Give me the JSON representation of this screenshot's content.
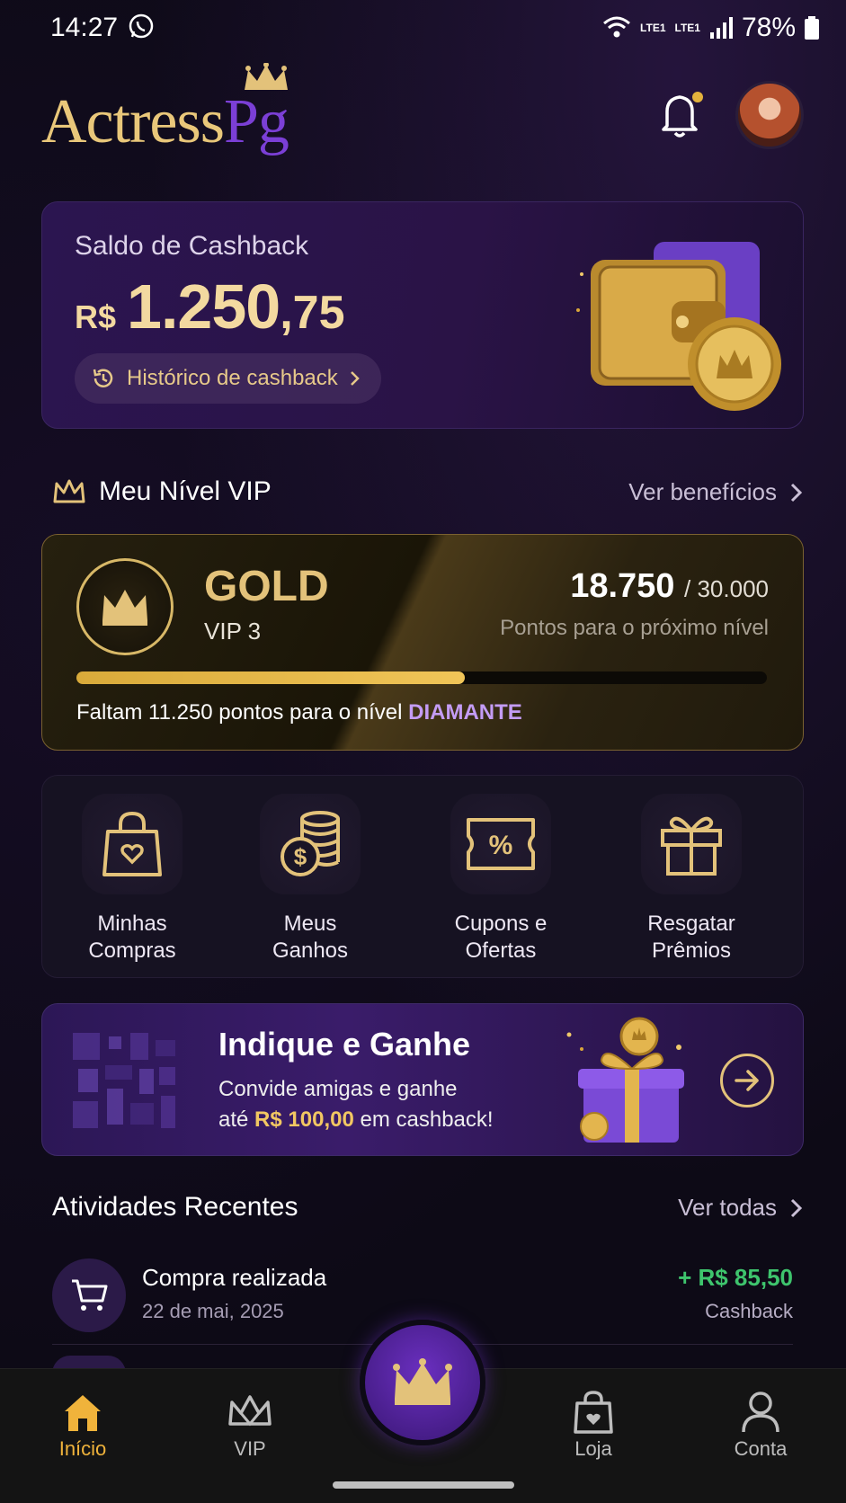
{
  "status_bar": {
    "time": "14:27",
    "net1": "LTE1",
    "net2": "LTE1",
    "battery": "78%"
  },
  "header": {
    "logo_part1": "Actress",
    "logo_part2": "Pg"
  },
  "cashback": {
    "label": "Saldo de Cashback",
    "currency": "R$",
    "amount_int": "1.250",
    "amount_dec": ",75",
    "history_label": "Histórico de cashback"
  },
  "vip_section": {
    "title": "Meu Nível VIP",
    "link": "Ver benefícios"
  },
  "vip_card": {
    "tier": "GOLD",
    "level": "VIP 3",
    "points": "18.750",
    "points_total": "/ 30.000",
    "points_label": "Pontos para o próximo nível",
    "progress": 0.5625,
    "need_text": "Faltam 11.250 pontos para o nível",
    "next_tier": "DIAMANTE"
  },
  "shortcuts": [
    {
      "line1": "Minhas",
      "line2": "Compras",
      "icon": "shopping-bag-heart-icon"
    },
    {
      "line1": "Meus",
      "line2": "Ganhos",
      "icon": "coins-icon"
    },
    {
      "line1": "Cupons e",
      "line2": "Ofertas",
      "icon": "coupon-icon"
    },
    {
      "line1": "Resgatar",
      "line2": "Prêmios",
      "icon": "gift-icon"
    }
  ],
  "refer": {
    "title": "Indique e Ganhe",
    "line1": "Convide amigas e ganhe",
    "line2_pre": "até",
    "line2_amount": "R$ 100,00",
    "line2_post": "em cashback!"
  },
  "activities": {
    "title": "Atividades Recentes",
    "link": "Ver todas",
    "items": [
      {
        "title": "Compra realizada",
        "date": "22 de mai, 2025",
        "value": "+ R$ 85,50",
        "sub": "Cashback"
      }
    ]
  },
  "nav": {
    "items": [
      "Início",
      "VIP",
      "Loja",
      "Conta"
    ]
  },
  "colors": {
    "gold": "#e3c27a",
    "purple": "#7b3fd6",
    "green": "#3ec46d",
    "active": "#f0b33b"
  }
}
